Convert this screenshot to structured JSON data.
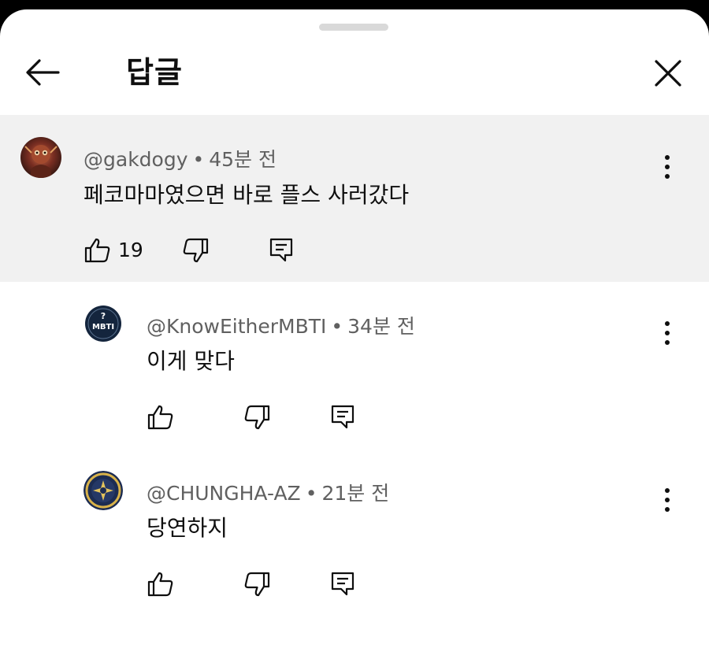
{
  "header": {
    "title": "답글",
    "back_icon": "arrow-left-icon",
    "close_icon": "close-icon"
  },
  "comments": [
    {
      "handle": "@gakdogy",
      "time": "45분 전",
      "text": "페코마마였으면 바로 플스 사러갔다",
      "likes": "19",
      "highlighted": true
    },
    {
      "handle": "@KnowEitherMBTI",
      "time": "34분 전",
      "text": "이게 맞다",
      "likes": "",
      "avatar_text": "MBTI"
    },
    {
      "handle": "@CHUNGHA-AZ",
      "time": "21분 전",
      "text": "당연하지",
      "likes": ""
    }
  ],
  "colors": {
    "highlight_bg": "#f1f1f1",
    "secondary_text": "#606060",
    "primary_text": "#0f0f0f"
  }
}
